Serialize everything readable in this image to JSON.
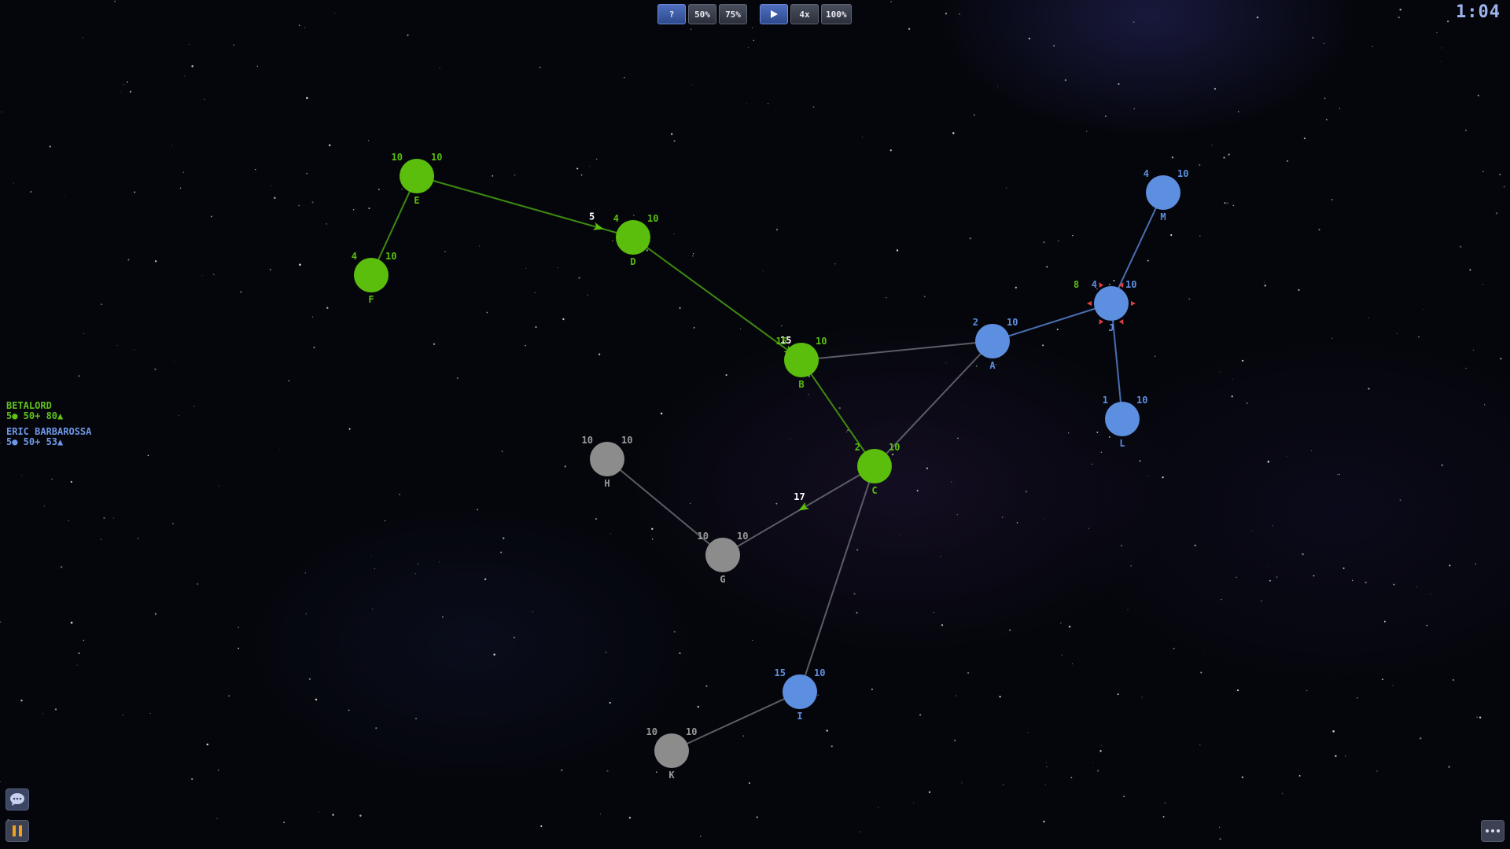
{
  "toolbar": {
    "help_label": "?",
    "zoom50_label": "50%",
    "zoom75_label": "75%",
    "play_icon": "play-icon",
    "speed4_label": "4x",
    "zoom100_label": "100%"
  },
  "timer": "1:04",
  "players": [
    {
      "name": "BETALORD",
      "stats": "5● 50+ 80▲",
      "color": "#5fc21a"
    },
    {
      "name": "ERIC BARBAROSSA",
      "stats": "5● 50+ 53▲",
      "color": "#6f98e8"
    }
  ],
  "colors": {
    "green": "#5bbd0c",
    "blue": "#5d8fe0",
    "neutral": "#8c8c8c",
    "red": "#e04040"
  },
  "nodes": [
    {
      "id": "E",
      "owner": "green",
      "ships": "10",
      "cap": "10"
    },
    {
      "id": "F",
      "owner": "green",
      "ships": "4",
      "cap": "10"
    },
    {
      "id": "D",
      "owner": "green",
      "ships": "4",
      "cap": "10"
    },
    {
      "id": "B",
      "owner": "green",
      "ships": "15",
      "cap": "10"
    },
    {
      "id": "C",
      "owner": "green",
      "ships": "2",
      "cap": "10"
    },
    {
      "id": "A",
      "owner": "blue",
      "ships": "2",
      "cap": "10"
    },
    {
      "id": "J",
      "owner": "blue",
      "ships": "4",
      "cap": "10",
      "attacker_ships": "8"
    },
    {
      "id": "M",
      "owner": "blue",
      "ships": "4",
      "cap": "10"
    },
    {
      "id": "L",
      "owner": "blue",
      "ships": "1",
      "cap": "10"
    },
    {
      "id": "I",
      "owner": "blue",
      "ships": "15",
      "cap": "10"
    },
    {
      "id": "H",
      "owner": "neutral",
      "ships": "10",
      "cap": "10"
    },
    {
      "id": "G",
      "owner": "neutral",
      "ships": "10",
      "cap": "10"
    },
    {
      "id": "K",
      "owner": "neutral",
      "ships": "10",
      "cap": "10"
    }
  ],
  "edges": [
    {
      "from": "E",
      "to": "F",
      "owner": "green"
    },
    {
      "from": "E",
      "to": "D",
      "owner": "green"
    },
    {
      "from": "D",
      "to": "B",
      "owner": "green"
    },
    {
      "from": "B",
      "to": "C",
      "owner": "green"
    },
    {
      "from": "B",
      "to": "A",
      "owner": "neutral"
    },
    {
      "from": "C",
      "to": "A",
      "owner": "neutral"
    },
    {
      "from": "C",
      "to": "G",
      "owner": "neutral"
    },
    {
      "from": "C",
      "to": "I",
      "owner": "neutral"
    },
    {
      "from": "H",
      "to": "G",
      "owner": "neutral"
    },
    {
      "from": "I",
      "to": "K",
      "owner": "neutral"
    },
    {
      "from": "A",
      "to": "J",
      "owner": "blue"
    },
    {
      "from": "J",
      "to": "M",
      "owner": "blue"
    },
    {
      "from": "J",
      "to": "L",
      "owner": "blue"
    }
  ],
  "fleets": [
    {
      "from": "E",
      "to": "D",
      "ships": "5",
      "progress": 0.84,
      "owner": "green"
    },
    {
      "from": "D",
      "to": "B",
      "ships": "15",
      "progress": 0.93,
      "owner": "green"
    },
    {
      "from": "C",
      "to": "G",
      "ships": "17",
      "progress": 0.47,
      "owner": "green"
    }
  ],
  "buttons": {
    "chat_icon": "chat-bubble-icon",
    "pause_icon": "pause-icon",
    "menu_icon": "more-dots-icon"
  }
}
